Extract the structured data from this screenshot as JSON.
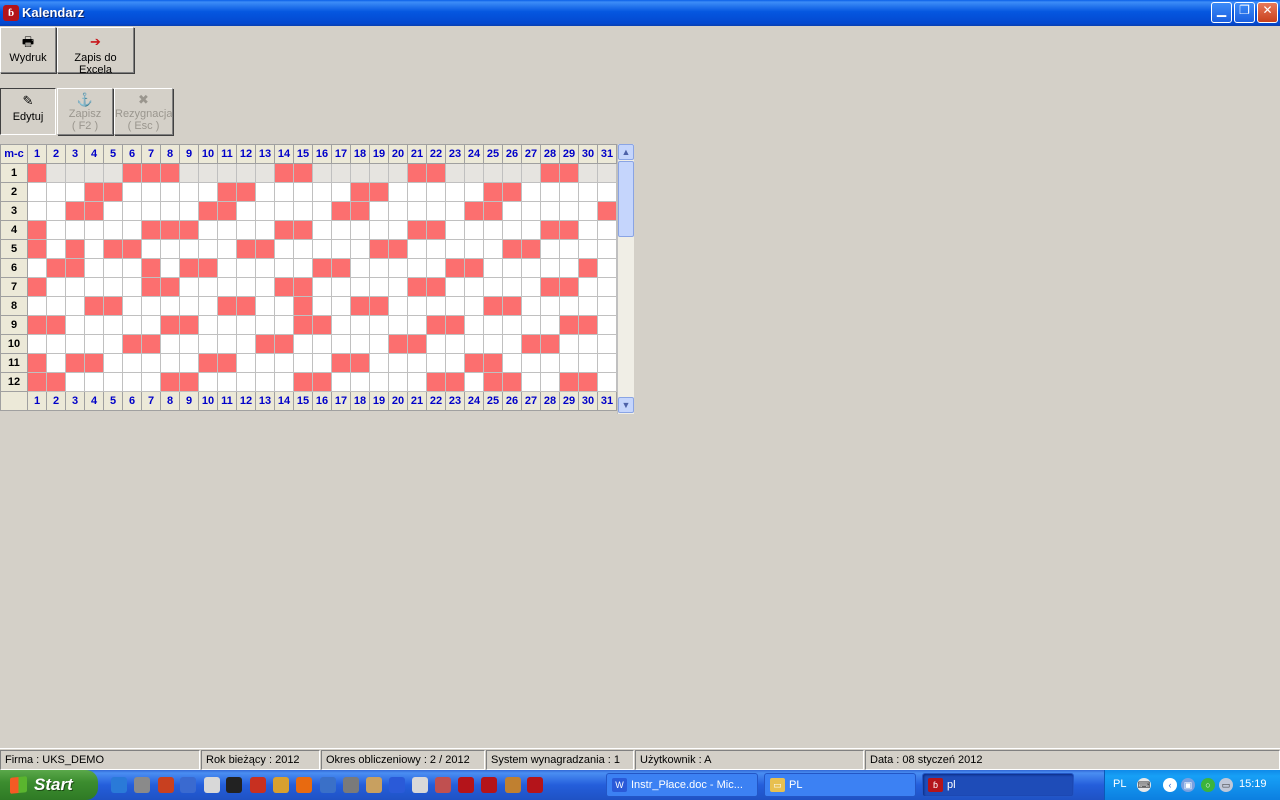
{
  "window": {
    "title": "Kalendarz",
    "app_icon_glyph": "ɓ"
  },
  "toolbar": {
    "print_label": "Wydruk",
    "excel_label": "Zapis do Excela",
    "edit_label": "Edytuj",
    "save_label": "Zapisz",
    "save_hotkey": "( F2 )",
    "cancel_label": "Rezygnacja",
    "cancel_hotkey": "( Esc )"
  },
  "calendar": {
    "corner_label": "m-c",
    "days": [
      "1",
      "2",
      "3",
      "4",
      "5",
      "6",
      "7",
      "8",
      "9",
      "10",
      "11",
      "12",
      "13",
      "14",
      "15",
      "16",
      "17",
      "18",
      "19",
      "20",
      "21",
      "22",
      "23",
      "24",
      "25",
      "26",
      "27",
      "28",
      "29",
      "30",
      "31"
    ],
    "months": [
      "1",
      "2",
      "3",
      "4",
      "5",
      "6",
      "7",
      "8",
      "9",
      "10",
      "11",
      "12"
    ],
    "selected_month_row": 1,
    "highlight_color": "#fc6f6f",
    "red_days": {
      "1": [
        1,
        6,
        7,
        8,
        14,
        15,
        21,
        22,
        28,
        29
      ],
      "2": [
        4,
        5,
        11,
        12,
        18,
        19,
        25,
        26
      ],
      "3": [
        3,
        4,
        10,
        11,
        17,
        18,
        24,
        25,
        31
      ],
      "4": [
        1,
        7,
        8,
        9,
        14,
        15,
        21,
        22,
        28,
        29
      ],
      "5": [
        1,
        3,
        5,
        6,
        12,
        13,
        19,
        20,
        26,
        27
      ],
      "6": [
        2,
        3,
        7,
        9,
        10,
        16,
        17,
        23,
        24,
        30
      ],
      "7": [
        1,
        7,
        8,
        14,
        15,
        21,
        22,
        28,
        29
      ],
      "8": [
        4,
        5,
        11,
        12,
        15,
        18,
        19,
        25,
        26
      ],
      "9": [
        1,
        2,
        8,
        9,
        15,
        16,
        22,
        23,
        29,
        30
      ],
      "10": [
        6,
        7,
        13,
        14,
        20,
        21,
        27,
        28
      ],
      "11": [
        1,
        3,
        4,
        10,
        11,
        17,
        18,
        24,
        25
      ],
      "12": [
        1,
        2,
        8,
        9,
        15,
        16,
        22,
        23,
        25,
        26,
        29,
        30
      ]
    }
  },
  "statusbar": {
    "firm": "Firma : UKS_DEMO",
    "year": "Rok bieżący : 2012",
    "period": "Okres obliczeniowy : 2 / 2012",
    "system": "System wynagradzania : 1",
    "user": "Użytkownik : A",
    "date": "Data : 08 styczeń 2012"
  },
  "taskbar": {
    "start_label": "Start",
    "items": [
      {
        "label": "Instr_Płace.doc - Mic...",
        "icon": "word-icon",
        "color": "#2a5ad8"
      },
      {
        "label": "PL",
        "icon": "folder-icon",
        "color": "#e8c050"
      },
      {
        "label": "pl",
        "icon": "app-icon",
        "color": "#b4141a"
      }
    ],
    "tray_language": "PL",
    "clock": "15:19"
  }
}
